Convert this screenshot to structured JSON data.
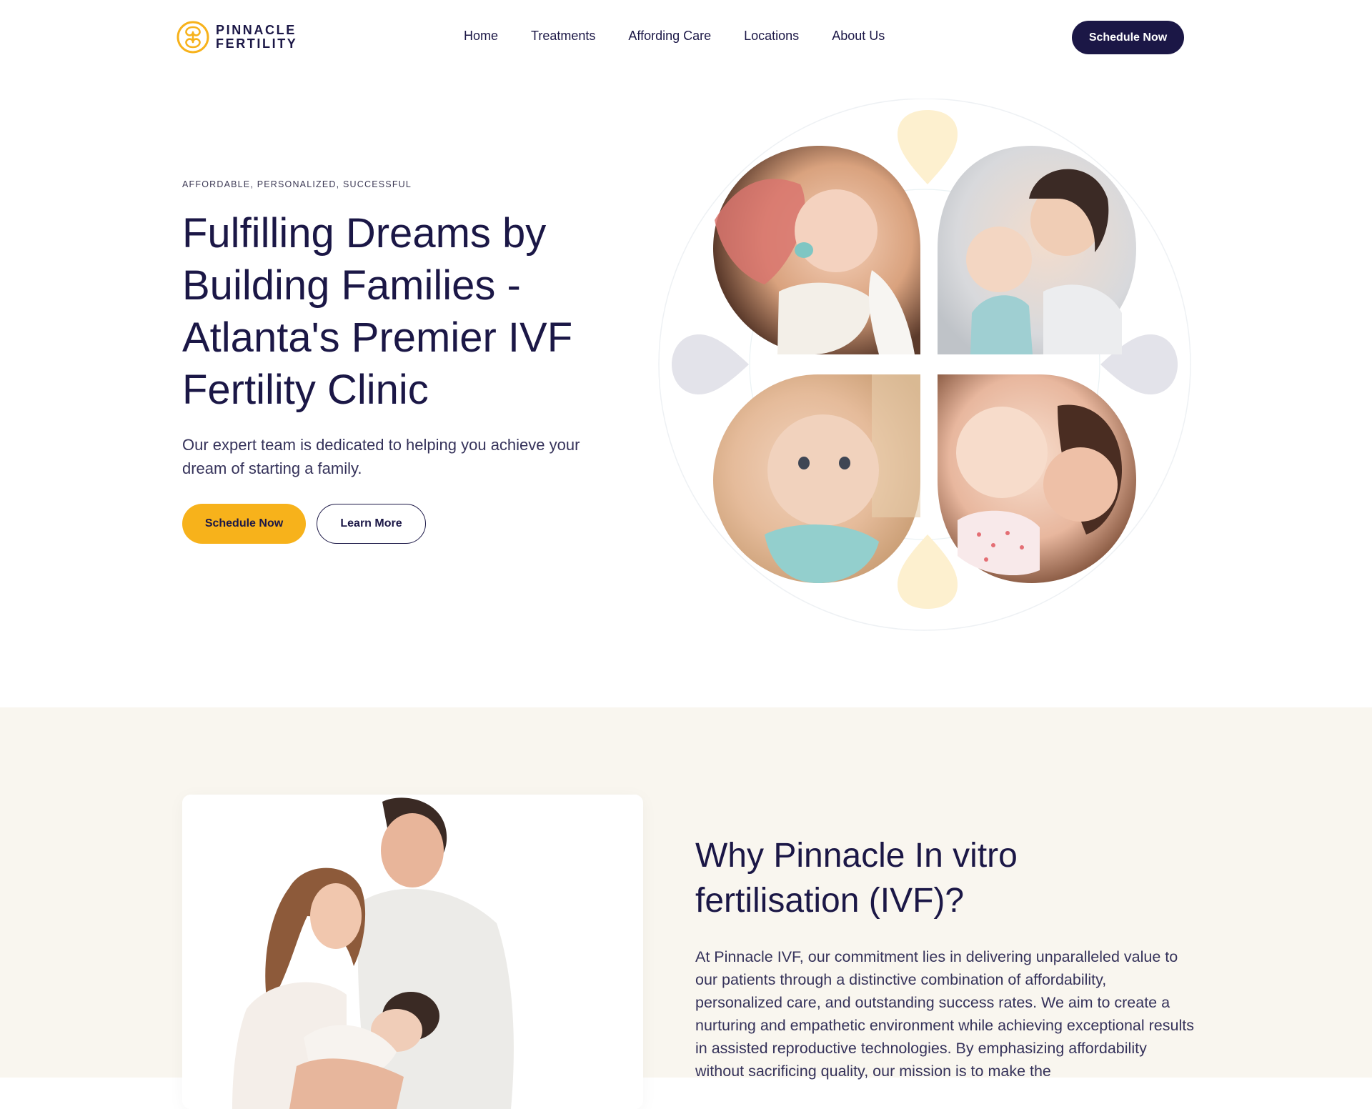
{
  "brand": {
    "line1": "PINNACLE",
    "line2": "FERTILITY",
    "accent": "#f7b21b",
    "navy": "#1b1746"
  },
  "nav": {
    "items": [
      {
        "label": "Home"
      },
      {
        "label": "Treatments"
      },
      {
        "label": "Affording Care"
      },
      {
        "label": "Locations"
      },
      {
        "label": "About Us"
      }
    ],
    "cta": "Schedule Now"
  },
  "hero": {
    "eyebrow": "AFFORDABLE, PERSONALIZED, SUCCESSFUL",
    "title": "Fulfilling Dreams by Building Families - Atlanta's Premier IVF Fertility Clinic",
    "subtitle": "Our expert team is dedicated to helping you achieve your dream of starting a family.",
    "primary_cta": "Schedule Now",
    "secondary_cta": "Learn More"
  },
  "why": {
    "title": "Why Pinnacle In vitro fertilisation (IVF)?",
    "body": "At Pinnacle IVF, our commitment lies in delivering unparalleled value to our patients through a distinctive combination of affordability, personalized care, and outstanding success rates. We aim to create a nurturing and empathetic environment while achieving exceptional results in assisted reproductive technologies. By emphasizing affordability without sacrificing quality, our mission is to make the"
  },
  "colors": {
    "section_bg": "#f9f6ef",
    "petal_yellow": "#fdf0cf",
    "petal_gray": "#e3e3ea"
  }
}
